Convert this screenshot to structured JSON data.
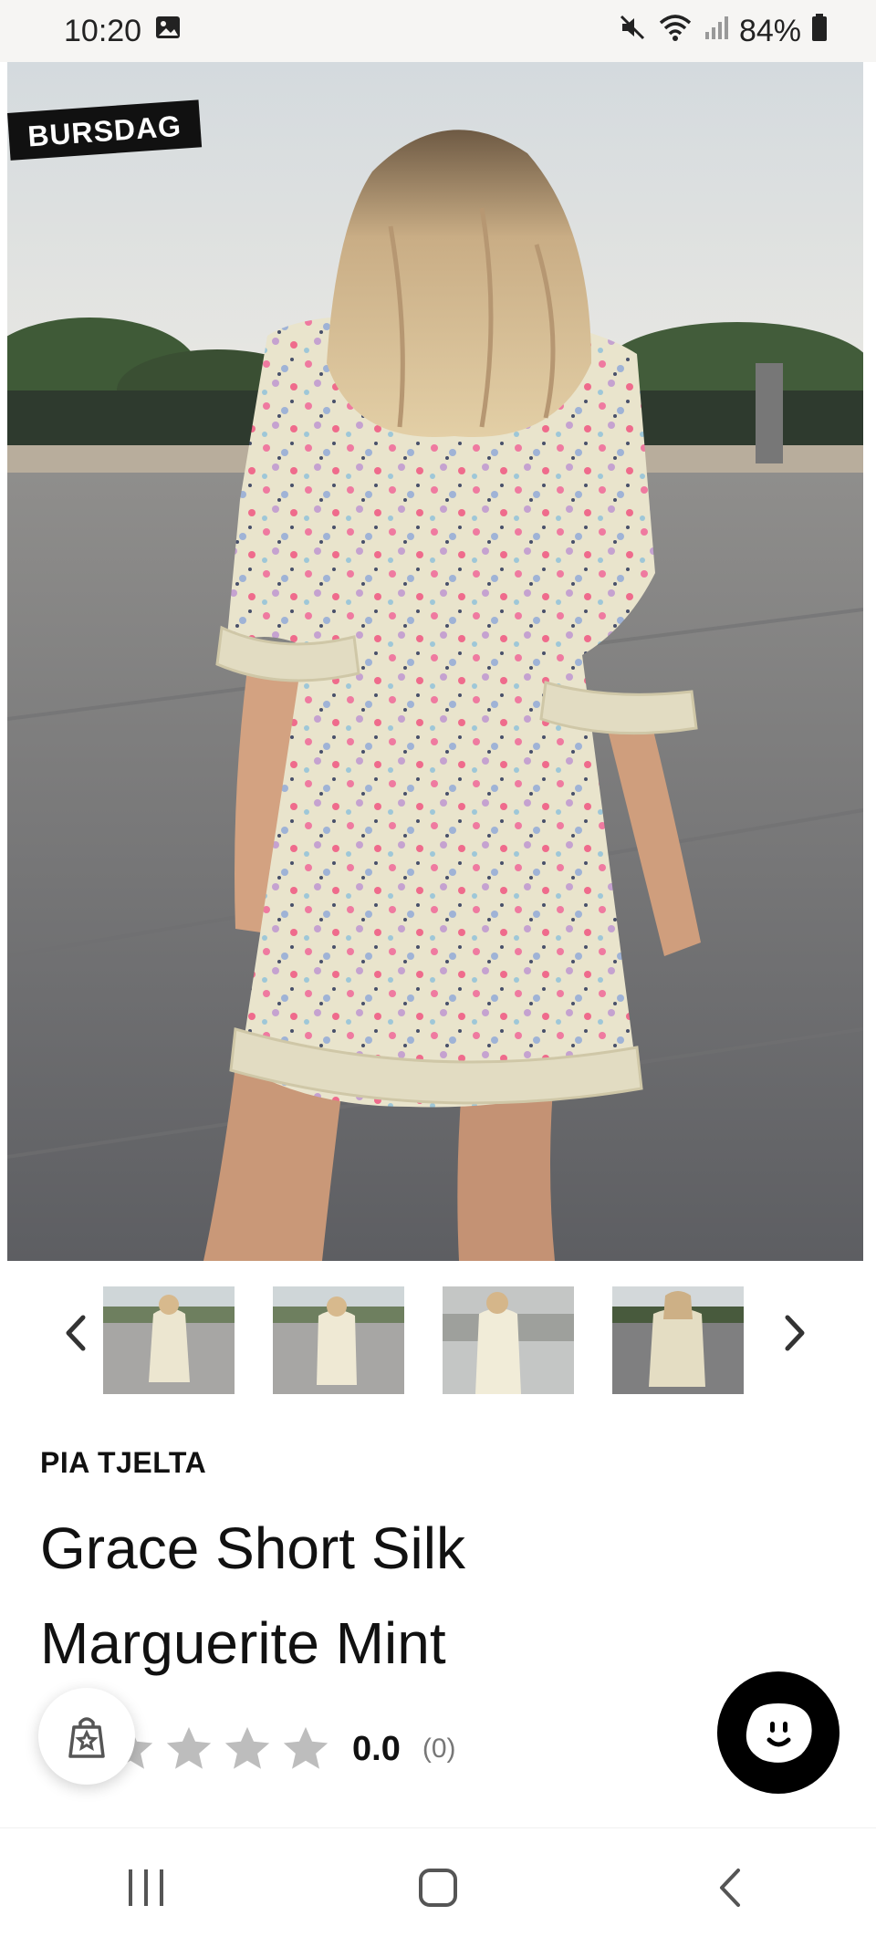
{
  "status_bar": {
    "time": "10:20",
    "battery": "84%",
    "icons": [
      "gallery-icon",
      "mute-icon",
      "wifi-icon",
      "signal-icon",
      "battery-icon"
    ]
  },
  "hero": {
    "badge_text": "BURSDAG"
  },
  "thumbnails": {
    "count": 4
  },
  "product": {
    "brand": "PIA TJELTA",
    "title_line1": "Grace Short Silk",
    "title_line2": "Marguerite Mint",
    "rating_score": "0.0",
    "rating_count": "(0)",
    "stars_filled": 0,
    "stars_total": 5
  },
  "colors": {
    "accent": "#000000",
    "star_empty": "#bdbdbd",
    "status_bg": "#f6f5f3"
  }
}
